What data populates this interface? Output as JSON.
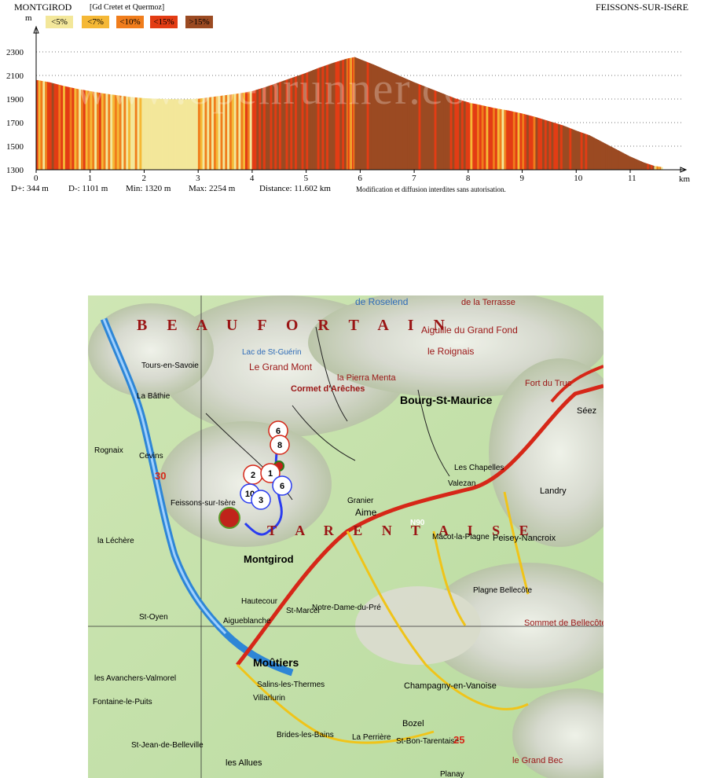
{
  "header": {
    "start_town": "MONTGIROD",
    "route_note": "[Gd Cretet et Quermoz]",
    "end_town": "FEISSONS-SUR-ISéRE",
    "y_unit": "m",
    "x_unit": "km"
  },
  "legend": [
    {
      "label": "<5%",
      "color": "#f3e79a"
    },
    {
      "label": "<7%",
      "color": "#f5b836"
    },
    {
      "label": "<10%",
      "color": "#f07d1c"
    },
    {
      "label": "<15%",
      "color": "#e33c14"
    },
    {
      "label": ">15%",
      "color": "#9b4a22"
    }
  ],
  "watermark": "www.openrunner.com",
  "stats": {
    "d_plus": "D+: 344 m",
    "d_minus": "D-: 1101 m",
    "min": "Min: 1320 m",
    "max": "Max: 2254 m",
    "distance": "Distance: 11.602 km",
    "notice": "Modification et diffusion interdites sans autorisation."
  },
  "chart_data": {
    "type": "area",
    "title": "",
    "xlabel": "km",
    "ylabel": "m",
    "xlim": [
      0,
      12
    ],
    "ylim": [
      1300,
      2400
    ],
    "x_ticks": [
      "0",
      "1",
      "2",
      "3",
      "4",
      "5",
      "6",
      "7",
      "8",
      "9",
      "10",
      "11"
    ],
    "y_ticks": [
      "1300",
      "1500",
      "1700",
      "1900",
      "2100",
      "2300"
    ],
    "grid": true,
    "series": [
      {
        "x": [
          0,
          0.25,
          0.5,
          0.75,
          1.0,
          1.25,
          1.5,
          1.75,
          2.0,
          2.25,
          2.5,
          2.75,
          3.0,
          3.25,
          3.5,
          3.75,
          4.0,
          4.25,
          4.5,
          4.75,
          5.0,
          5.25,
          5.5,
          5.75,
          5.9,
          6.0,
          6.25,
          6.5,
          6.75,
          7.0,
          7.25,
          7.5,
          7.75,
          8.0,
          8.25,
          8.5,
          8.75,
          9.0,
          9.25,
          9.5,
          9.75,
          10.0,
          10.25,
          10.5,
          10.75,
          11.0,
          11.25,
          11.45,
          11.6
        ],
        "y": [
          2060,
          2040,
          2010,
          1985,
          1965,
          1945,
          1930,
          1915,
          1905,
          1900,
          1897,
          1895,
          1900,
          1915,
          1930,
          1945,
          1965,
          2000,
          2040,
          2080,
          2120,
          2165,
          2205,
          2240,
          2254,
          2235,
          2190,
          2140,
          2090,
          2040,
          1995,
          1950,
          1905,
          1870,
          1845,
          1820,
          1800,
          1775,
          1745,
          1710,
          1675,
          1630,
          1590,
          1530,
          1470,
          1410,
          1360,
          1330,
          1320
        ]
      }
    ]
  },
  "map": {
    "labels": [
      {
        "text": "B E A U F O R T A I N"
      },
      {
        "text": "T A R E N T A I S E"
      },
      {
        "text": "Bourg-St-Maurice"
      },
      {
        "text": "Moûtiers"
      },
      {
        "text": "Montgirod"
      },
      {
        "text": "Aime"
      },
      {
        "text": "Feissons-sur-Isère"
      },
      {
        "text": "La Bâthie"
      },
      {
        "text": "Tours-en-Savoie"
      },
      {
        "text": "Aigueblanche"
      },
      {
        "text": "Le Grand Mont"
      },
      {
        "text": "Cormet d'Arêches"
      },
      {
        "text": "la Pierra Menta"
      },
      {
        "text": "Landry"
      },
      {
        "text": "Peisey-Nancroix"
      },
      {
        "text": "Bozel"
      },
      {
        "text": "Champagny-en-Vanoise"
      },
      {
        "text": "Brides-les-Bains"
      },
      {
        "text": "Séez"
      },
      {
        "text": "Mâcot-la-Plagne"
      },
      {
        "text": "Aiguille du Grand Fond"
      },
      {
        "text": "le Roignais"
      },
      {
        "text": "Valezan"
      },
      {
        "text": "Les Chapelles"
      },
      {
        "text": "Granier"
      },
      {
        "text": "St-Marcel"
      },
      {
        "text": "Notre-Dame-du-Pré"
      },
      {
        "text": "Hautecour"
      },
      {
        "text": "Villarlurin"
      },
      {
        "text": "Salins-les-Thermes"
      },
      {
        "text": "les Avanchers-Valmorel"
      },
      {
        "text": "St-Oyen"
      },
      {
        "text": "Cevins"
      },
      {
        "text": "Rognaix"
      },
      {
        "text": "la Léchère"
      },
      {
        "text": "Sommet de Bellecôte"
      },
      {
        "text": "le Grand Bec"
      },
      {
        "text": "St-Bon-Tarentaise"
      },
      {
        "text": "La Perrière"
      },
      {
        "text": "Planay"
      },
      {
        "text": "Fontaine-le-Puits"
      },
      {
        "text": "St-Jean-de-Belleville"
      },
      {
        "text": "les Allues"
      },
      {
        "text": "Lac de St-Guérin"
      },
      {
        "text": "de Roselend"
      },
      {
        "text": "de la Terrasse"
      },
      {
        "text": "Fort du Truc"
      },
      {
        "text": "Plagne Bellecôte"
      },
      {
        "text": "N90"
      },
      {
        "text": "30"
      },
      {
        "text": "25"
      }
    ],
    "markers": [
      "6",
      "8",
      "2",
      "1",
      "6",
      "10",
      "3"
    ]
  }
}
